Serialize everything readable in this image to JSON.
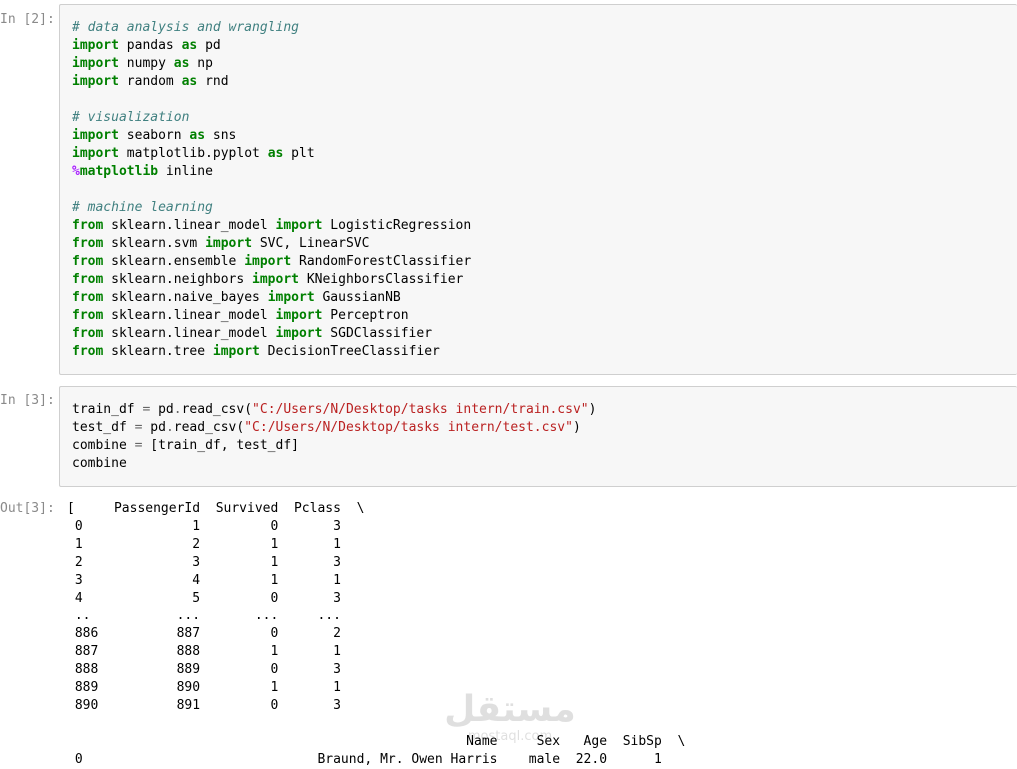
{
  "cells": [
    {
      "prompt": "In [2]:",
      "lines": [
        [
          {
            "t": "# data analysis and wrangling",
            "c": "cm"
          }
        ],
        [
          {
            "t": "import",
            "c": "kw"
          },
          {
            "t": " pandas "
          },
          {
            "t": "as",
            "c": "kw"
          },
          {
            "t": " pd"
          }
        ],
        [
          {
            "t": "import",
            "c": "kw"
          },
          {
            "t": " numpy "
          },
          {
            "t": "as",
            "c": "kw"
          },
          {
            "t": " np"
          }
        ],
        [
          {
            "t": "import",
            "c": "kw"
          },
          {
            "t": " random "
          },
          {
            "t": "as",
            "c": "kw"
          },
          {
            "t": " rnd"
          }
        ],
        [],
        [
          {
            "t": "# visualization",
            "c": "cm"
          }
        ],
        [
          {
            "t": "import",
            "c": "kw"
          },
          {
            "t": " seaborn "
          },
          {
            "t": "as",
            "c": "kw"
          },
          {
            "t": " sns"
          }
        ],
        [
          {
            "t": "import",
            "c": "kw"
          },
          {
            "t": " matplotlib.pyplot "
          },
          {
            "t": "as",
            "c": "kw"
          },
          {
            "t": " plt"
          }
        ],
        [
          {
            "t": "%",
            "c": "mag"
          },
          {
            "t": "matplotlib",
            "c": "kw"
          },
          {
            "t": " inline"
          }
        ],
        [],
        [
          {
            "t": "# machine learning",
            "c": "cm"
          }
        ],
        [
          {
            "t": "from",
            "c": "kw"
          },
          {
            "t": " sklearn.linear_model "
          },
          {
            "t": "import",
            "c": "kw"
          },
          {
            "t": " LogisticRegression"
          }
        ],
        [
          {
            "t": "from",
            "c": "kw"
          },
          {
            "t": " sklearn.svm "
          },
          {
            "t": "import",
            "c": "kw"
          },
          {
            "t": " SVC, LinearSVC"
          }
        ],
        [
          {
            "t": "from",
            "c": "kw"
          },
          {
            "t": " sklearn.ensemble "
          },
          {
            "t": "import",
            "c": "kw"
          },
          {
            "t": " RandomForestClassifier"
          }
        ],
        [
          {
            "t": "from",
            "c": "kw"
          },
          {
            "t": " sklearn.neighbors "
          },
          {
            "t": "import",
            "c": "kw"
          },
          {
            "t": " KNeighborsClassifier"
          }
        ],
        [
          {
            "t": "from",
            "c": "kw"
          },
          {
            "t": " sklearn.naive_bayes "
          },
          {
            "t": "import",
            "c": "kw"
          },
          {
            "t": " GaussianNB"
          }
        ],
        [
          {
            "t": "from",
            "c": "kw"
          },
          {
            "t": " sklearn.linear_model "
          },
          {
            "t": "import",
            "c": "kw"
          },
          {
            "t": " Perceptron"
          }
        ],
        [
          {
            "t": "from",
            "c": "kw"
          },
          {
            "t": " sklearn.linear_model "
          },
          {
            "t": "import",
            "c": "kw"
          },
          {
            "t": " SGDClassifier"
          }
        ],
        [
          {
            "t": "from",
            "c": "kw"
          },
          {
            "t": " sklearn.tree "
          },
          {
            "t": "import",
            "c": "kw"
          },
          {
            "t": " DecisionTreeClassifier"
          }
        ]
      ]
    },
    {
      "prompt": "In [3]:",
      "lines": [
        [
          {
            "t": "train_df "
          },
          {
            "t": "=",
            "c": "op"
          },
          {
            "t": " pd"
          },
          {
            "t": ".",
            "c": "op"
          },
          {
            "t": "read_csv("
          },
          {
            "t": "\"C:/Users/N/Desktop/tasks intern/train.csv\"",
            "c": "str"
          },
          {
            "t": ")"
          }
        ],
        [
          {
            "t": "test_df "
          },
          {
            "t": "=",
            "c": "op"
          },
          {
            "t": " pd"
          },
          {
            "t": ".",
            "c": "op"
          },
          {
            "t": "read_csv("
          },
          {
            "t": "\"C:/Users/N/Desktop/tasks intern/test.csv\"",
            "c": "str"
          },
          {
            "t": ")"
          }
        ],
        [
          {
            "t": "combine "
          },
          {
            "t": "=",
            "c": "op"
          },
          {
            "t": " [train_df, test_df]"
          }
        ],
        [
          {
            "t": "combine"
          }
        ]
      ]
    }
  ],
  "output": {
    "prompt": "Out[3]:",
    "lines": [
      "[     PassengerId  Survived  Pclass  \\",
      " 0              1         0       3",
      " 1              2         1       1",
      " 2              3         1       3",
      " 3              4         1       1",
      " 4              5         0       3",
      " ..           ...       ...     ...",
      " 886          887         0       2",
      " 887          888         1       1",
      " 888          889         0       3",
      " 889          890         1       1",
      " 890          891         0       3",
      "",
      "                                                   Name     Sex   Age  SibSp  \\",
      " 0                              Braund, Mr. Owen Harris    male  22.0      1"
    ]
  },
  "watermark": {
    "text": "مستقل",
    "sub": "mostaql.com"
  }
}
